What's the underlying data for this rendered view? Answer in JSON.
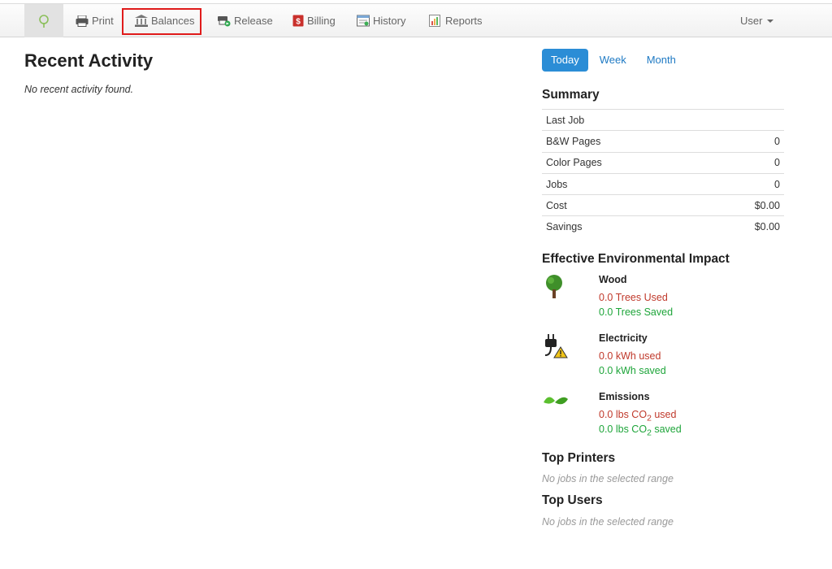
{
  "nav": {
    "items": [
      {
        "label": "Print",
        "icon": "printer-icon"
      },
      {
        "label": "Balances",
        "icon": "bank-icon"
      },
      {
        "label": "Release",
        "icon": "release-icon"
      },
      {
        "label": "Billing",
        "icon": "billing-icon"
      },
      {
        "label": "History",
        "icon": "history-icon"
      },
      {
        "label": "Reports",
        "icon": "reports-icon"
      }
    ],
    "user_label": "User"
  },
  "main": {
    "title": "Recent Activity",
    "empty_message": "No recent activity found."
  },
  "range_tabs": [
    {
      "label": "Today",
      "active": true
    },
    {
      "label": "Week",
      "active": false
    },
    {
      "label": "Month",
      "active": false
    }
  ],
  "summary": {
    "heading": "Summary",
    "rows": [
      {
        "label": "Last Job",
        "value": ""
      },
      {
        "label": "B&W Pages",
        "value": "0"
      },
      {
        "label": "Color Pages",
        "value": "0"
      },
      {
        "label": "Jobs",
        "value": "0"
      },
      {
        "label": "Cost",
        "value": "$0.00"
      },
      {
        "label": "Savings",
        "value": "$0.00"
      }
    ]
  },
  "impact": {
    "heading": "Effective Environmental Impact",
    "wood": {
      "title": "Wood",
      "used": "0.0 Trees Used",
      "saved": "0.0 Trees Saved"
    },
    "electricity": {
      "title": "Electricity",
      "used": "0.0 kWh used",
      "saved": "0.0 kWh saved"
    },
    "emissions": {
      "title": "Emissions",
      "used_prefix": "0.0 lbs CO",
      "used_suffix": " used",
      "saved_prefix": "0.0 lbs CO",
      "saved_suffix": " saved",
      "subscript": "2"
    }
  },
  "top_printers": {
    "heading": "Top Printers",
    "empty": "No jobs in the selected range"
  },
  "top_users": {
    "heading": "Top Users",
    "empty": "No jobs in the selected range"
  },
  "colors": {
    "accent": "#2b8dd6",
    "used": "#c0392b",
    "saved": "#1ea53a",
    "highlight": "#e01b1b"
  }
}
